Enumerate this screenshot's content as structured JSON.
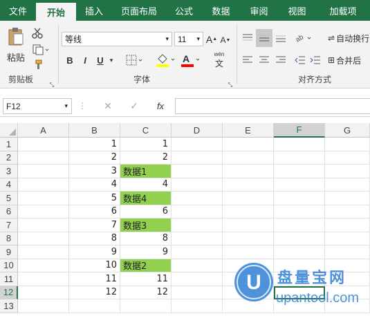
{
  "tabs": [
    "文件",
    "开始",
    "插入",
    "页面布局",
    "公式",
    "数据",
    "审阅",
    "视图",
    "加载项"
  ],
  "ribbon": {
    "paste_label": "粘贴",
    "clipboard_label": "剪贴板",
    "font_name": "等线",
    "font_size": "11",
    "bold": "B",
    "italic": "I",
    "underline": "U",
    "font_group_label": "字体",
    "align_group_label": "对齐方式",
    "wrap_text": "自动换行",
    "merge_center": "合并后",
    "increase_font": "A",
    "decrease_font": "A",
    "phonetic": "wén"
  },
  "formula_bar": {
    "name_box": "F12",
    "fx": "fx",
    "formula": ""
  },
  "columns": [
    "A",
    "B",
    "C",
    "D",
    "E",
    "F",
    "G"
  ],
  "rows": [
    "1",
    "2",
    "3",
    "4",
    "5",
    "6",
    "7",
    "8",
    "9",
    "10",
    "11",
    "12",
    "13"
  ],
  "col_b": [
    "1",
    "2",
    "3",
    "4",
    "5",
    "6",
    "7",
    "8",
    "9",
    "10",
    "11",
    "12",
    ""
  ],
  "col_c": [
    "1",
    "2",
    "数据1",
    "4",
    "数据4",
    "6",
    "数据3",
    "8",
    "9",
    "数据2",
    "11",
    "12",
    ""
  ],
  "watermark": {
    "brand": "盘量宝网",
    "url": "upantool.com",
    "letter": "U"
  },
  "colors": {
    "accent": "#217346",
    "highlight": "#92d050"
  }
}
